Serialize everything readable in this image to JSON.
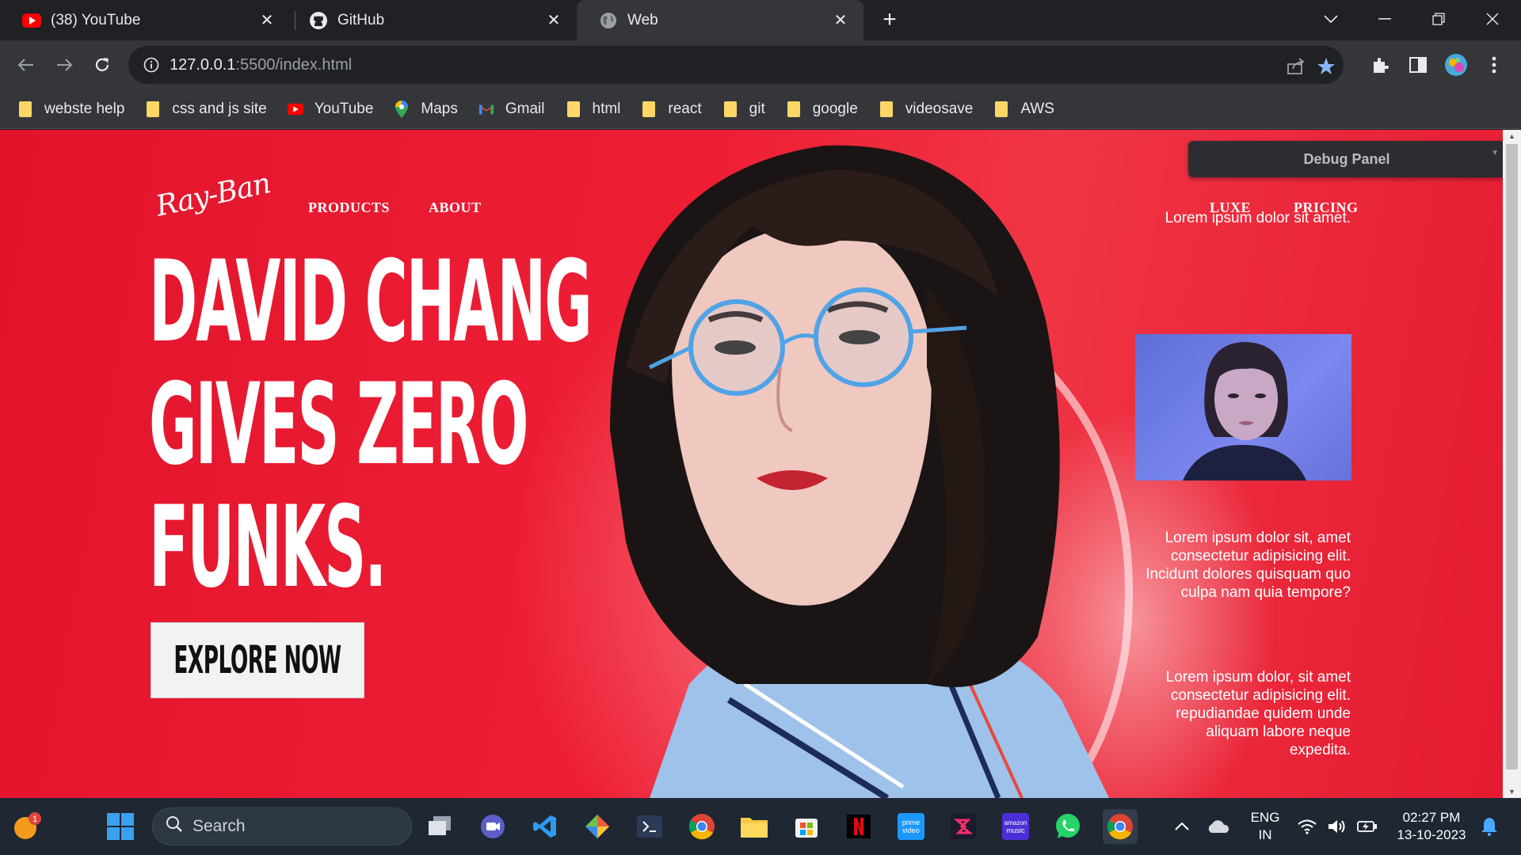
{
  "tabs": [
    {
      "title": "(38) YouTube",
      "icon": "youtube-icon"
    },
    {
      "title": "GitHub",
      "icon": "github-icon"
    },
    {
      "title": "Web",
      "icon": "globe-icon",
      "active": true
    }
  ],
  "address_bar": {
    "host": "127.0.0.1",
    "path": ":5500/index.html"
  },
  "bookmarks": [
    {
      "label": "webste help",
      "icon": "folder-icon"
    },
    {
      "label": "css and js site",
      "icon": "folder-icon"
    },
    {
      "label": "YouTube",
      "icon": "youtube-icon"
    },
    {
      "label": "Maps",
      "icon": "maps-icon"
    },
    {
      "label": "Gmail",
      "icon": "gmail-icon"
    },
    {
      "label": "html",
      "icon": "folder-icon"
    },
    {
      "label": "react",
      "icon": "folder-icon"
    },
    {
      "label": "git",
      "icon": "folder-icon"
    },
    {
      "label": "google",
      "icon": "folder-icon"
    },
    {
      "label": "videosave",
      "icon": "folder-icon"
    },
    {
      "label": "AWS",
      "icon": "folder-icon"
    }
  ],
  "page": {
    "logo": "Ray-Ban",
    "nav_left": [
      "PRODUCTS",
      "ABOUT"
    ],
    "nav_right": [
      "LUXE",
      "PRICING"
    ],
    "headline": [
      "DAVID CHANG",
      "GIVES ZERO",
      "FUNKS."
    ],
    "cta": "EXPLORE NOW",
    "debug_panel": "Debug Panel",
    "side_text_1": "Lorem ipsum dolor sit amet.",
    "side_text_2": "Lorem ipsum dolor sit, amet consectetur adipisicing elit. Incidunt dolores quisquam quo culpa nam quia tempore?",
    "side_text_3": "Lorem ipsum dolor, sit amet consectetur adipisicing elit. repudiandae quidem unde aliquam labore neque expedita.",
    "accent": "#e8192f"
  },
  "taskbar": {
    "search_placeholder": "Search",
    "notification_badge": "1",
    "language": "ENG",
    "region": "IN",
    "time": "02:27 PM",
    "date": "13-10-2023"
  }
}
